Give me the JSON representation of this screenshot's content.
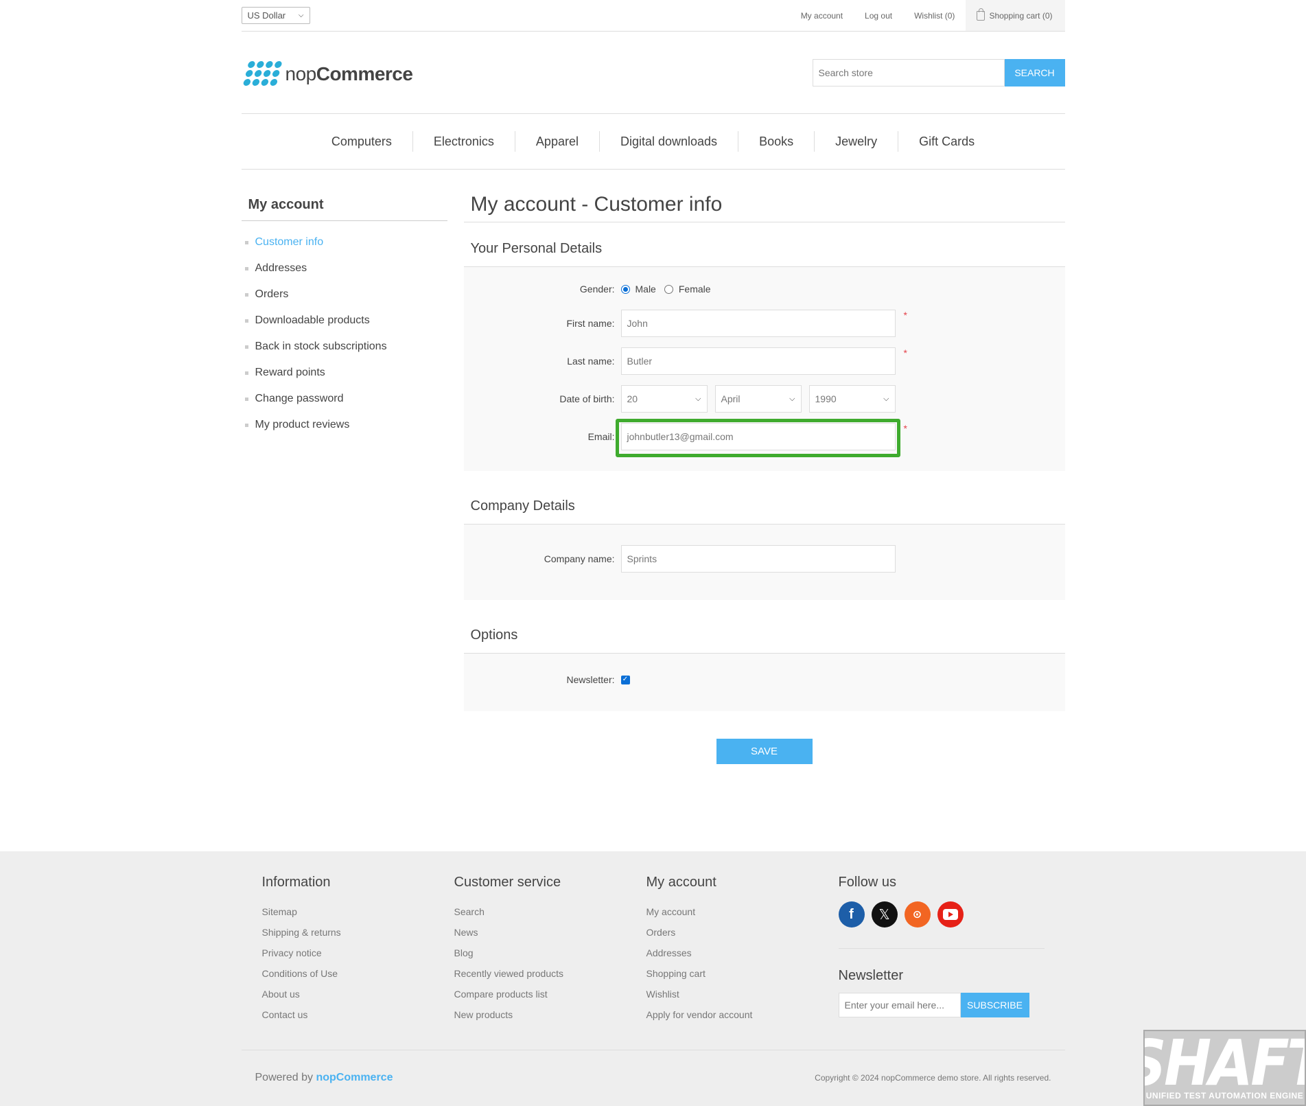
{
  "header": {
    "currency": "US Dollar",
    "links": [
      "My account",
      "Log out",
      "Wishlist (0)"
    ],
    "cart": "Shopping cart (0)"
  },
  "logo": {
    "text_light": "nop",
    "text_bold": "Commerce"
  },
  "search": {
    "placeholder": "Search store",
    "button": "Search"
  },
  "menu": [
    "Computers",
    "Electronics",
    "Apparel",
    "Digital downloads",
    "Books",
    "Jewelry",
    "Gift Cards"
  ],
  "sidebar": {
    "title": "My account",
    "items": [
      {
        "label": "Customer info",
        "active": true
      },
      {
        "label": "Addresses"
      },
      {
        "label": "Orders"
      },
      {
        "label": "Downloadable products"
      },
      {
        "label": "Back in stock subscriptions"
      },
      {
        "label": "Reward points"
      },
      {
        "label": "Change password"
      },
      {
        "label": "My product reviews"
      }
    ]
  },
  "main": {
    "title": "My account - Customer info",
    "personal": {
      "title": "Your Personal Details",
      "gender_label": "Gender:",
      "gender_male": "Male",
      "gender_female": "Female",
      "gender_selected": "Male",
      "first_name_label": "First name:",
      "first_name": "John",
      "last_name_label": "Last name:",
      "last_name": "Butler",
      "dob_label": "Date of birth:",
      "dob_day": "20",
      "dob_month": "April",
      "dob_year": "1990",
      "email_label": "Email:",
      "email": "johnbutler13@gmail.com",
      "required_mark": "*"
    },
    "company": {
      "title": "Company Details",
      "company_label": "Company name:",
      "company_name": "Sprints"
    },
    "options": {
      "title": "Options",
      "newsletter_label": "Newsletter:",
      "newsletter_checked": true
    },
    "save": "Save"
  },
  "footer": {
    "information": {
      "title": "Information",
      "items": [
        "Sitemap",
        "Shipping & returns",
        "Privacy notice",
        "Conditions of Use",
        "About us",
        "Contact us"
      ]
    },
    "customer_service": {
      "title": "Customer service",
      "items": [
        "Search",
        "News",
        "Blog",
        "Recently viewed products",
        "Compare products list",
        "New products"
      ]
    },
    "my_account": {
      "title": "My account",
      "items": [
        "My account",
        "Orders",
        "Addresses",
        "Shopping cart",
        "Wishlist",
        "Apply for vendor account"
      ]
    },
    "follow": {
      "title": "Follow us",
      "icons": [
        "facebook-icon",
        "x-icon",
        "rss-icon",
        "youtube-icon"
      ]
    },
    "newsletter": {
      "title": "Newsletter",
      "placeholder": "Enter your email here...",
      "button": "Subscribe"
    },
    "powered_prefix": "Powered by",
    "powered_link": "nopCommerce",
    "copyright": "Copyright © 2024 nopCommerce demo store. All rights reserved."
  },
  "watermark": {
    "big": "SHAFT",
    "small": "UNIFIED TEST AUTOMATION ENGINE"
  },
  "colors": {
    "accent": "#4ab2f1",
    "highlight": "#3fab2e",
    "required": "#e4434b"
  }
}
